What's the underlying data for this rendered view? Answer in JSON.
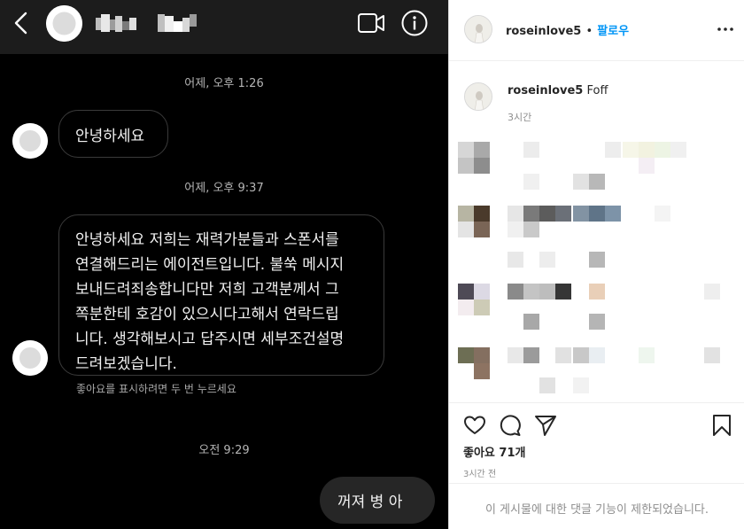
{
  "dm": {
    "messages": [
      {
        "time": "어제, 오후 1:26",
        "text": "안녕하세요"
      },
      {
        "time": "어제, 오후 9:37",
        "text": "안녕하세요 저희는 재력가분들과 스폰서를\n연결해드리는 에이전트입니다. 불쑥 메시지\n보내드려죄송합니다만 저희 고객분께서 그\n쪽분한테 호감이 있으시다고해서 연락드립\n니다. 생각해보시고 답주시면 세부조건설명\n드려보겠습니다."
      }
    ],
    "like_hint": "좋아요를 표시하려면 두 번 누르세요",
    "reply": {
      "time": "오전 9:29",
      "text": "꺼져 병  아"
    }
  },
  "post": {
    "username": "roseinlove5",
    "dot": "•",
    "follow": "팔로우",
    "caption_text": "Foff",
    "caption_time": "3시간",
    "likes": "좋아요 71개",
    "time": "3시간 전",
    "comments_disabled": "이 게시물에 대한 댓글 기능이 제한되었습니다."
  },
  "icons": {
    "back": "chevron-left",
    "video": "video-camera",
    "info": "info-circle",
    "more": "three-dots",
    "heart": "heart-outline",
    "comment": "speech-bubble",
    "share": "paper-plane",
    "bookmark": "bookmark-outline"
  },
  "colors": {
    "follow": "#0095f6",
    "dm_background": "#000000",
    "outgoing_bubble": "#262626"
  }
}
